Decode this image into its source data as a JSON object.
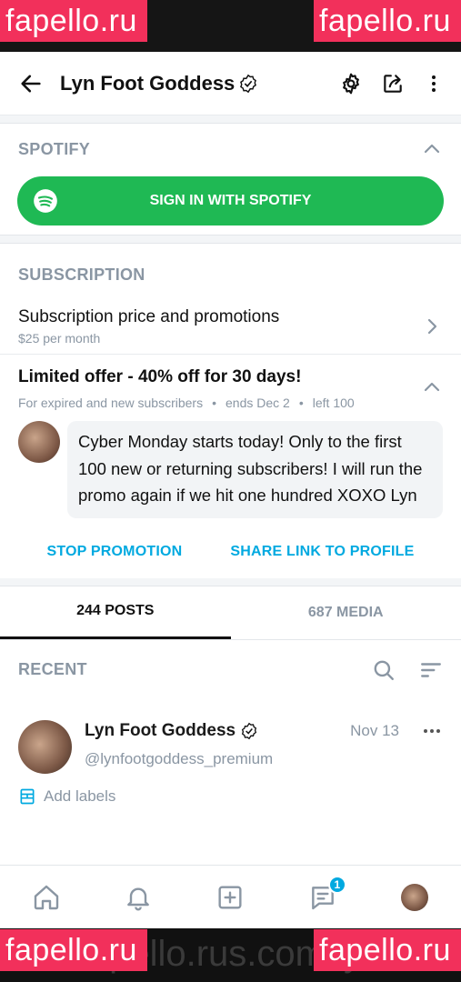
{
  "watermark": "fapello.ru",
  "watermark_url": "fapello.rus.com/lyn",
  "header": {
    "title": "Lyn Foot Goddess"
  },
  "spotify": {
    "section_title": "SPOTIFY",
    "button_label": "SIGN IN WITH SPOTIFY",
    "brand_color": "#1fb954"
  },
  "subscription": {
    "section_title": "SUBSCRIPTION",
    "row_title": "Subscription price and promotions",
    "price": "$25 per month"
  },
  "offer": {
    "title": "Limited offer - 40% off for 30 days!",
    "meta": [
      "For expired and new subscribers",
      "ends Dec 2",
      "left 100"
    ],
    "message": "Cyber Monday starts today! Only to the first 100 new or returning subscribers! I will run the promo again if we hit one hundred XOXO Lyn",
    "stop_label": "STOP PROMOTION",
    "share_label": "SHARE LINK TO PROFILE",
    "accent_color": "#00a9e0"
  },
  "tabs": [
    {
      "label": "244 POSTS",
      "active": true
    },
    {
      "label": "687 MEDIA",
      "active": false
    }
  ],
  "recent": {
    "title": "RECENT"
  },
  "post": {
    "name": "Lyn Foot Goddess",
    "date": "Nov 13",
    "handle": "@lynfootgoddess_premium",
    "labels_text": "Add labels"
  },
  "nav": {
    "messages_badge": "1"
  }
}
